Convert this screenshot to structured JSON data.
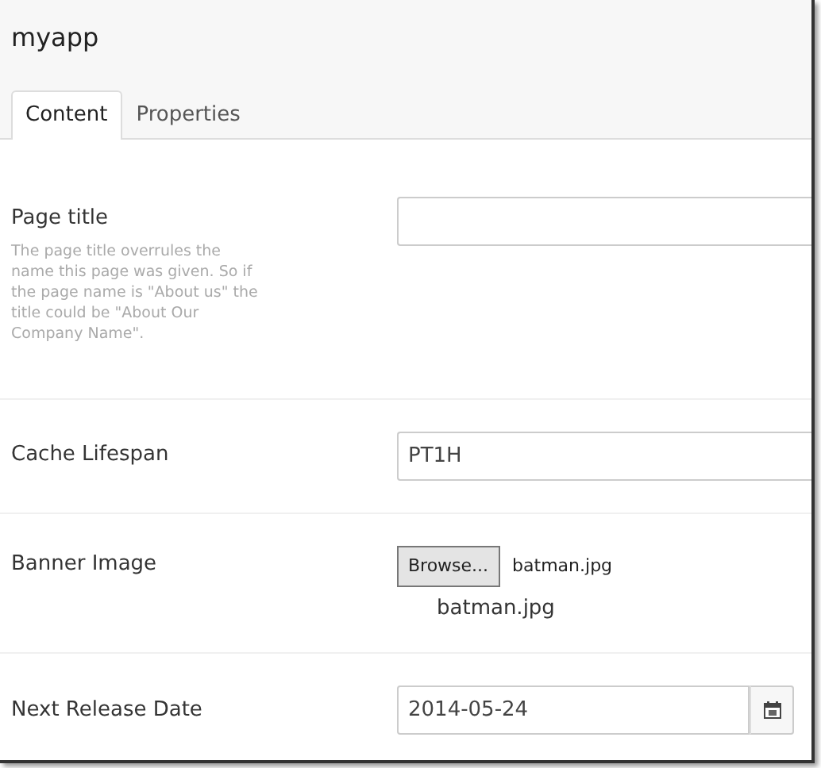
{
  "app": {
    "title": "myapp"
  },
  "tabs": [
    {
      "label": "Content",
      "selected": true
    },
    {
      "label": "Properties",
      "selected": false
    }
  ],
  "fields": [
    {
      "kind": "text",
      "label": "Page title",
      "description": "The page title overrules the name this page was given. So if the page name is \"About us\" the title could be \"About Our Company Name\"."
    },
    {
      "kind": "text",
      "label": "Cache Lifespan",
      "value": "PT1H"
    },
    {
      "kind": "file",
      "label": "Banner Image",
      "button": "Browse...",
      "file_name": "batman.jpg",
      "current_file": "batman.jpg"
    },
    {
      "kind": "date",
      "label": "Next Release Date",
      "value": "2014-05-24"
    }
  ]
}
